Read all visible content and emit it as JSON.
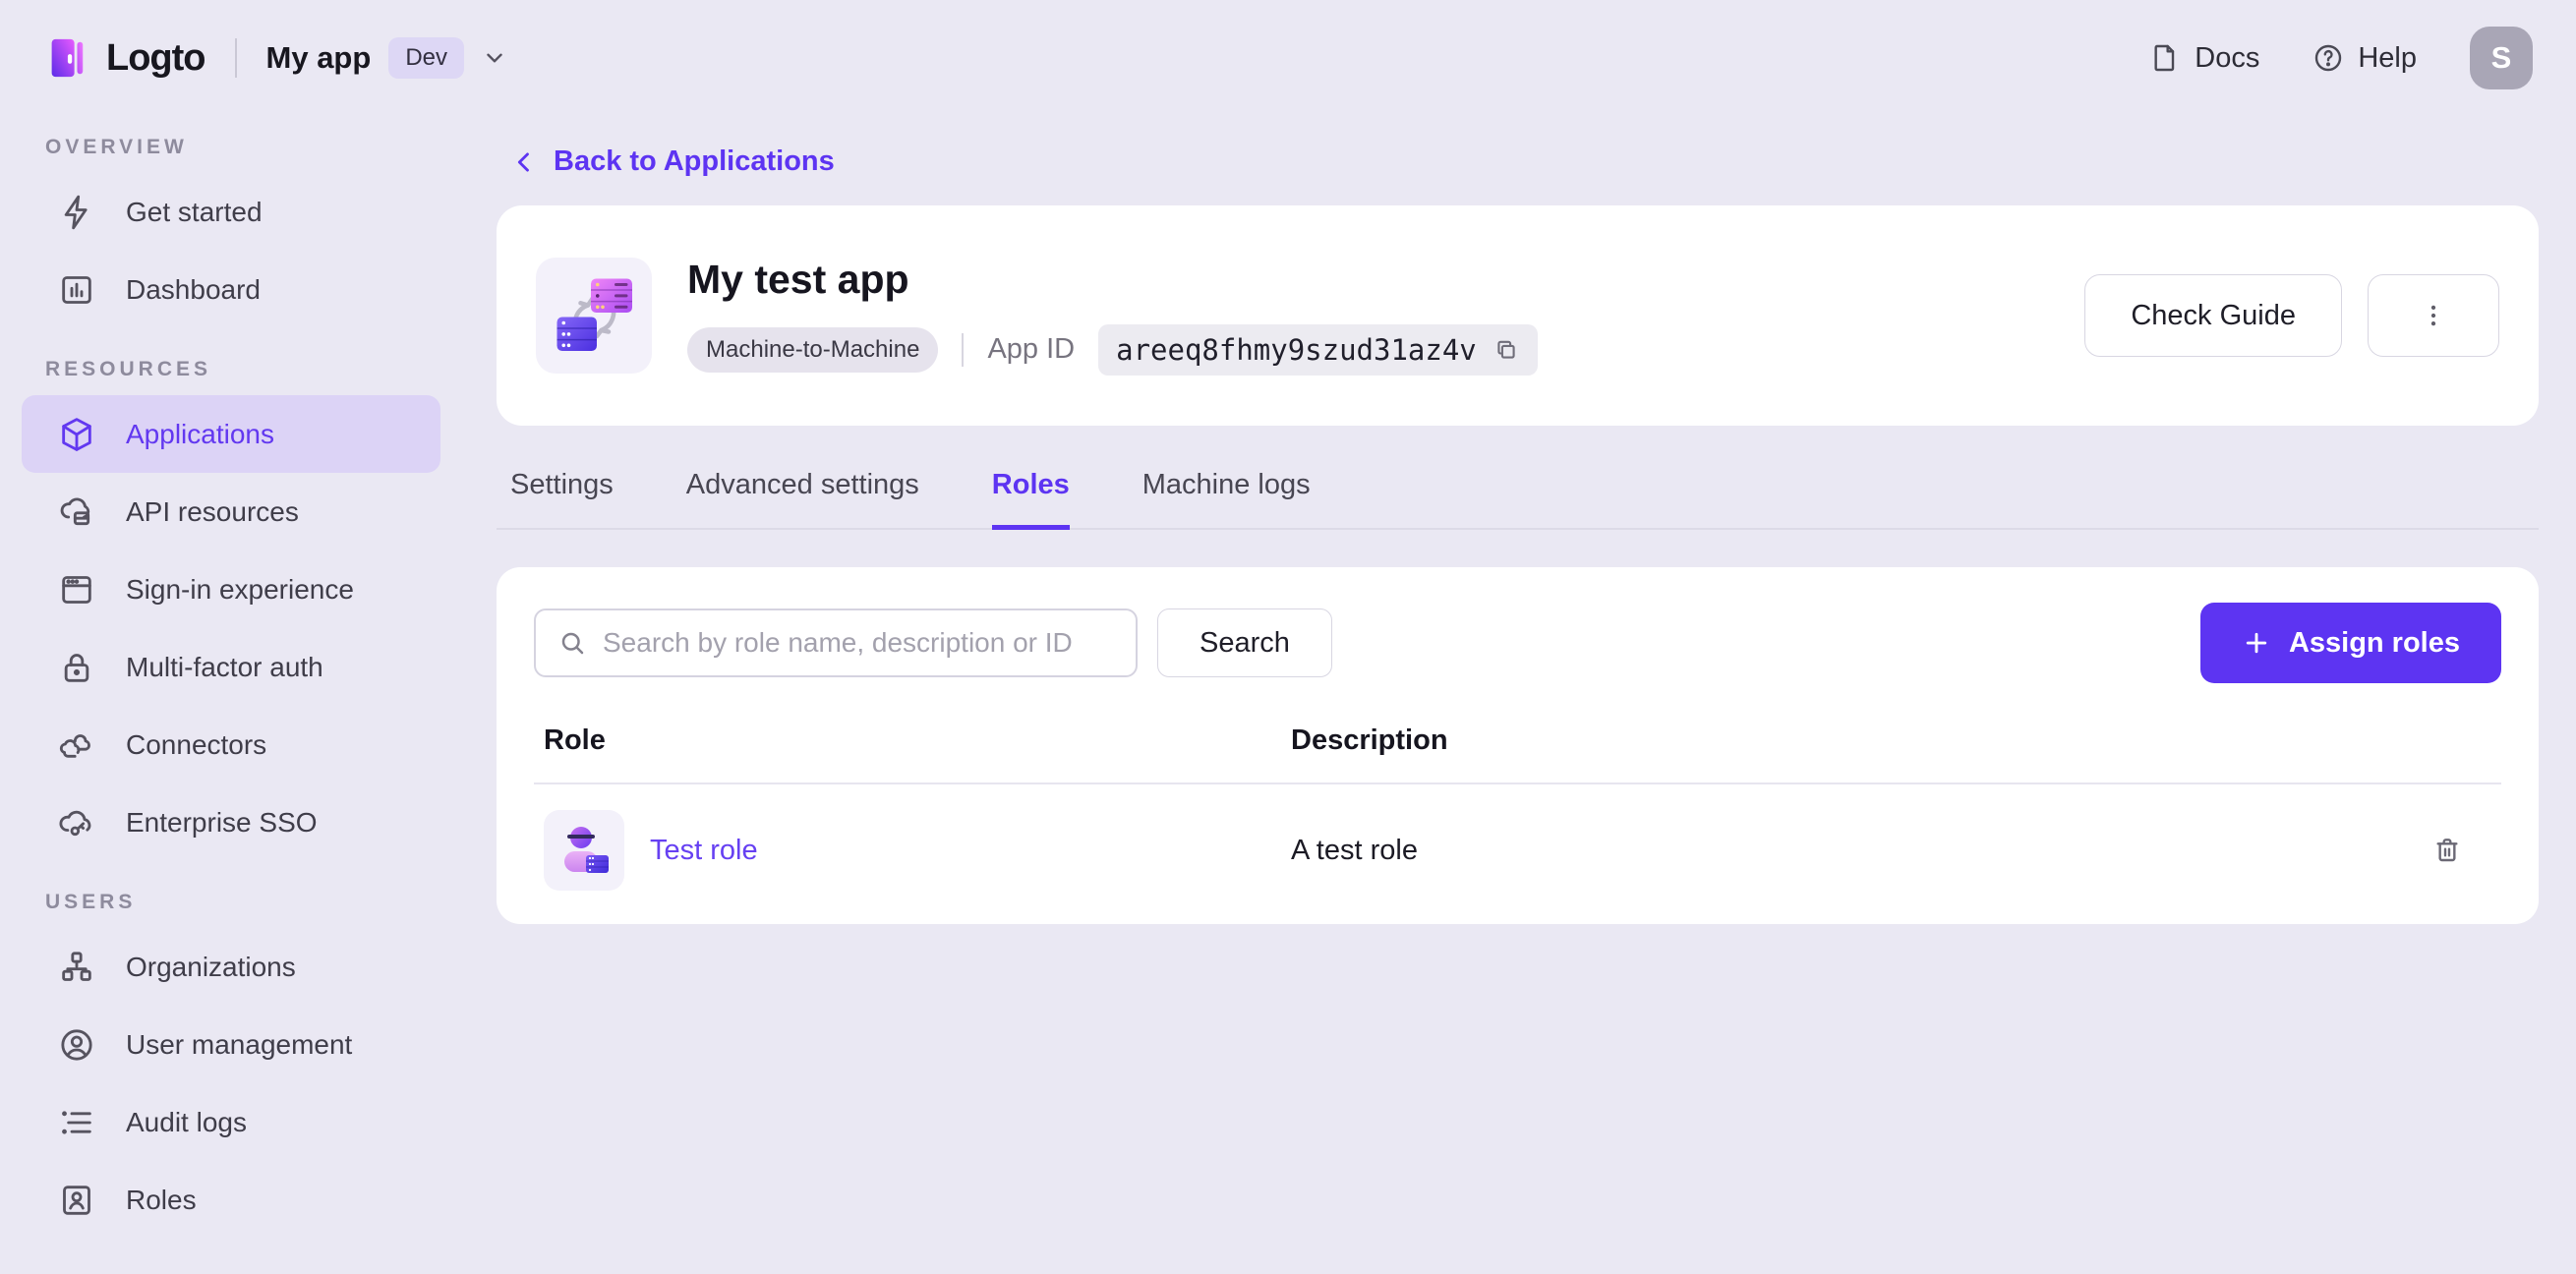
{
  "colors": {
    "accent": "#5d34f2",
    "accent_link": "#6640f2",
    "sidebar_selected_bg": "#dcd3f6",
    "page_bg": "#eae8f3",
    "card_bg": "#ffffff"
  },
  "topbar": {
    "logo_text": "Logto",
    "app_switcher": {
      "name": "My app",
      "env_badge": "Dev"
    },
    "docs_label": "Docs",
    "help_label": "Help",
    "avatar_initial": "S"
  },
  "sidebar": {
    "sections": [
      {
        "label": "OVERVIEW",
        "items": [
          {
            "label": "Get started"
          },
          {
            "label": "Dashboard"
          }
        ]
      },
      {
        "label": "RESOURCES",
        "items": [
          {
            "label": "Applications",
            "active": true
          },
          {
            "label": "API resources"
          },
          {
            "label": "Sign-in experience"
          },
          {
            "label": "Multi-factor auth"
          },
          {
            "label": "Connectors"
          },
          {
            "label": "Enterprise SSO"
          }
        ]
      },
      {
        "label": "USERS",
        "items": [
          {
            "label": "Organizations"
          },
          {
            "label": "User management"
          },
          {
            "label": "Audit logs"
          },
          {
            "label": "Roles"
          }
        ]
      }
    ]
  },
  "page": {
    "back_link": "Back to Applications",
    "app_header": {
      "title": "My test app",
      "type_badge": "Machine-to-Machine",
      "app_id_label": "App ID",
      "app_id": "areeq8fhmy9szud31az4v",
      "check_guide_button": "Check Guide"
    },
    "tabs": [
      {
        "label": "Settings"
      },
      {
        "label": "Advanced settings"
      },
      {
        "label": "Roles",
        "active": true
      },
      {
        "label": "Machine logs"
      }
    ],
    "roles_panel": {
      "search_placeholder": "Search by role name, description or ID",
      "search_button": "Search",
      "assign_button": "Assign roles",
      "table": {
        "headers": [
          "Role",
          "Description"
        ],
        "rows": [
          {
            "role": "Test role",
            "description": "A test role"
          }
        ]
      }
    }
  }
}
